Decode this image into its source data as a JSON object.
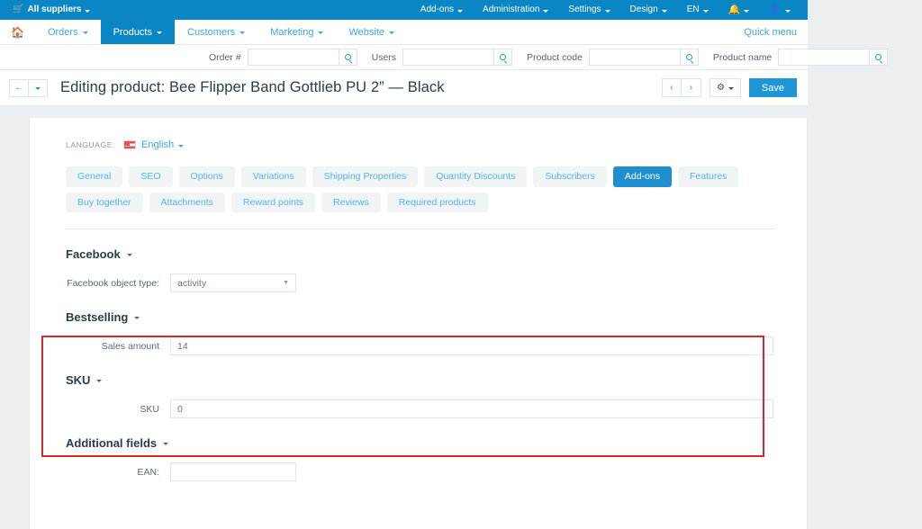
{
  "topbar": {
    "cart_icon": "cart-icon",
    "suppliers": "All suppliers",
    "right_items": [
      {
        "label": "Add-ons",
        "name": "addons"
      },
      {
        "label": "Administration",
        "name": "administration"
      },
      {
        "label": "Settings",
        "name": "settings"
      },
      {
        "label": "Design",
        "name": "design"
      },
      {
        "label": "EN",
        "name": "language"
      }
    ],
    "bell_icon": "bell-icon",
    "user_icon": "user-icon"
  },
  "nav": {
    "home_icon": "home-icon",
    "items": [
      {
        "label": "Orders",
        "active": false
      },
      {
        "label": "Products",
        "active": true
      },
      {
        "label": "Customers",
        "active": false
      },
      {
        "label": "Marketing",
        "active": false
      },
      {
        "label": "Website",
        "active": false
      }
    ],
    "quick_menu": "Quick menu"
  },
  "search": {
    "fields": [
      {
        "label": "Order #",
        "value": "",
        "placeholder": ""
      },
      {
        "label": "Users",
        "value": "",
        "placeholder": ""
      },
      {
        "label": "Product code",
        "value": "",
        "placeholder": ""
      },
      {
        "label": "Product name",
        "value": "",
        "placeholder": ""
      }
    ],
    "search_icon": "search-icon"
  },
  "title_bar": {
    "back_icon": "arrow-left-icon",
    "back_dropdown_icon": "caret-down-icon",
    "title": "Editing product: Bee Flipper Band Gottlieb PU 2” — Black",
    "prev_icon": "chevron-left-icon",
    "next_icon": "chevron-right-icon",
    "gear_icon": "gear-icon",
    "save_label": "Save"
  },
  "language": {
    "label": "LANGUAGE:",
    "flag_icon": "flag-icon",
    "name": "English"
  },
  "tabs": [
    {
      "label": "General",
      "active": false
    },
    {
      "label": "SEO",
      "active": false
    },
    {
      "label": "Options",
      "active": false
    },
    {
      "label": "Variations",
      "active": false
    },
    {
      "label": "Shipping Properties",
      "active": false
    },
    {
      "label": "Quantity Discounts",
      "active": false
    },
    {
      "label": "Subscribers",
      "active": false
    },
    {
      "label": "Add-ons",
      "active": true
    },
    {
      "label": "Features",
      "active": false
    },
    {
      "label": "Buy together",
      "active": false
    },
    {
      "label": "Attachments",
      "active": false
    },
    {
      "label": "Reward points",
      "active": false
    },
    {
      "label": "Reviews",
      "active": false
    },
    {
      "label": "Required products",
      "active": false
    }
  ],
  "sections": {
    "facebook": {
      "title": "Facebook",
      "field_label": "Facebook object type:",
      "field_value": "activity"
    },
    "bestselling": {
      "title": "Bestselling",
      "field_label": "Sales amount",
      "field_value": "14"
    },
    "sku": {
      "title": "SKU",
      "field_label": "SKU",
      "field_value": "0"
    },
    "additional_fields": {
      "title": "Additional fields",
      "field_label": "EAN:",
      "field_value": ""
    }
  },
  "colors": {
    "brand_blue": "#0a86c4",
    "link_blue": "#3ba7dd",
    "accent_blue": "#2196d6",
    "highlight_red": "#d32a2a",
    "page_bg": "#eceff1"
  }
}
